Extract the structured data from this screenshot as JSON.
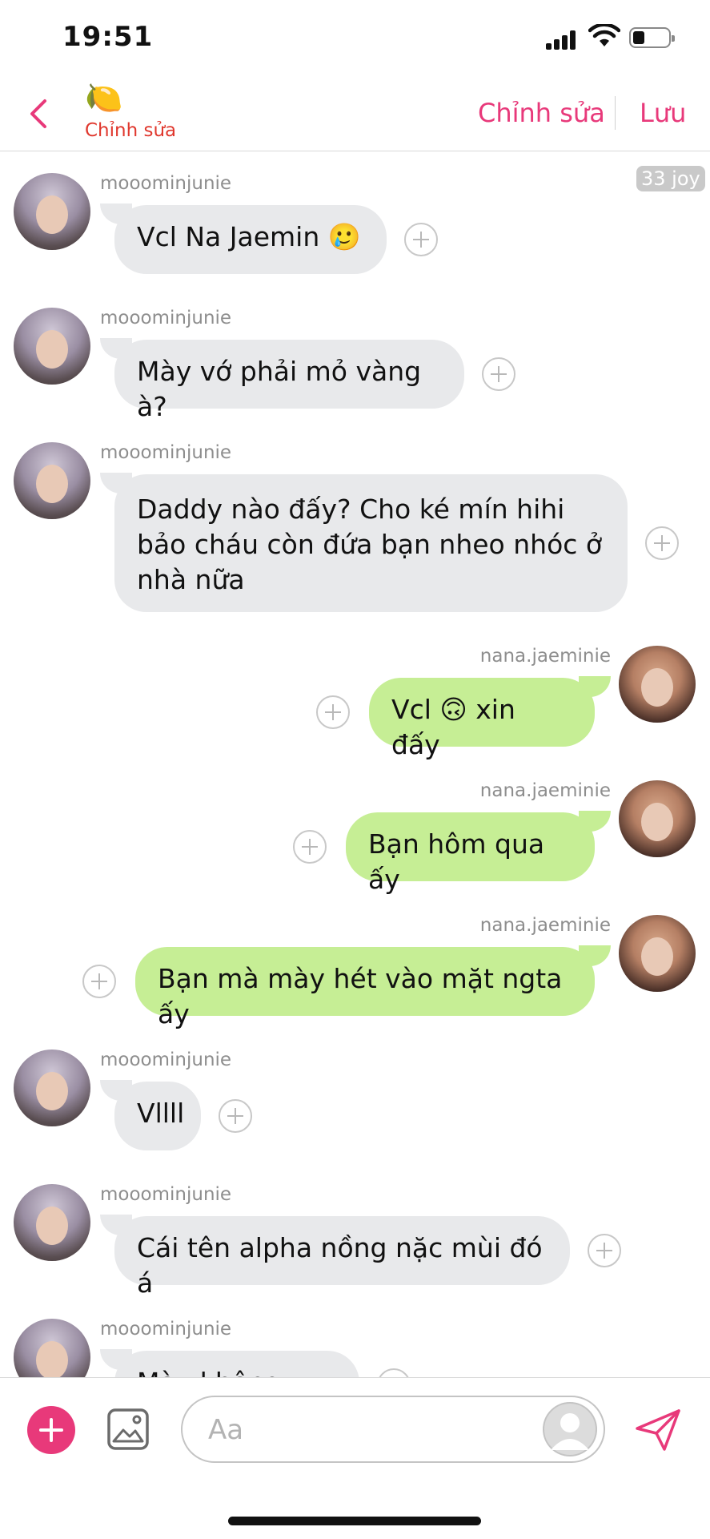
{
  "status_bar": {
    "time": "19:51"
  },
  "header": {
    "lemon_emoji": "🍋",
    "subtitle": "Chỉnh sửa",
    "edit_label": "Chỉnh sửa",
    "save_label": "Lưu"
  },
  "badge": "33 joy",
  "messages": [
    {
      "sender": "mooominjunie",
      "text": "Vcl Na Jaemin 🥲"
    },
    {
      "sender": "mooominjunie",
      "text": "Mày vớ phải mỏ vàng à?"
    },
    {
      "sender": "mooominjunie",
      "text": "Daddy nào đấy? Cho ké mín hihi bảo cháu còn đứa bạn nheo nhóc ở nhà nữa"
    },
    {
      "sender": "nana.jaeminie",
      "text": "Vcl 🙃 xin đấy"
    },
    {
      "sender": "nana.jaeminie",
      "text": "Bạn hôm qua ấy"
    },
    {
      "sender": "nana.jaeminie",
      "text": "Bạn mà mày hét vào mặt ngta ấy"
    },
    {
      "sender": "mooominjunie",
      "text": "Vllll"
    },
    {
      "sender": "mooominjunie",
      "text": "Cái tên alpha nồng nặc mùi đó á"
    },
    {
      "sender": "mooominjunie",
      "text": "Mày không nói..."
    }
  ],
  "input": {
    "placeholder": "Aa"
  },
  "colors": {
    "accent": "#e8397a",
    "incoming_bubble": "#e8e9eb",
    "outgoing_bubble": "#c6ee95"
  }
}
